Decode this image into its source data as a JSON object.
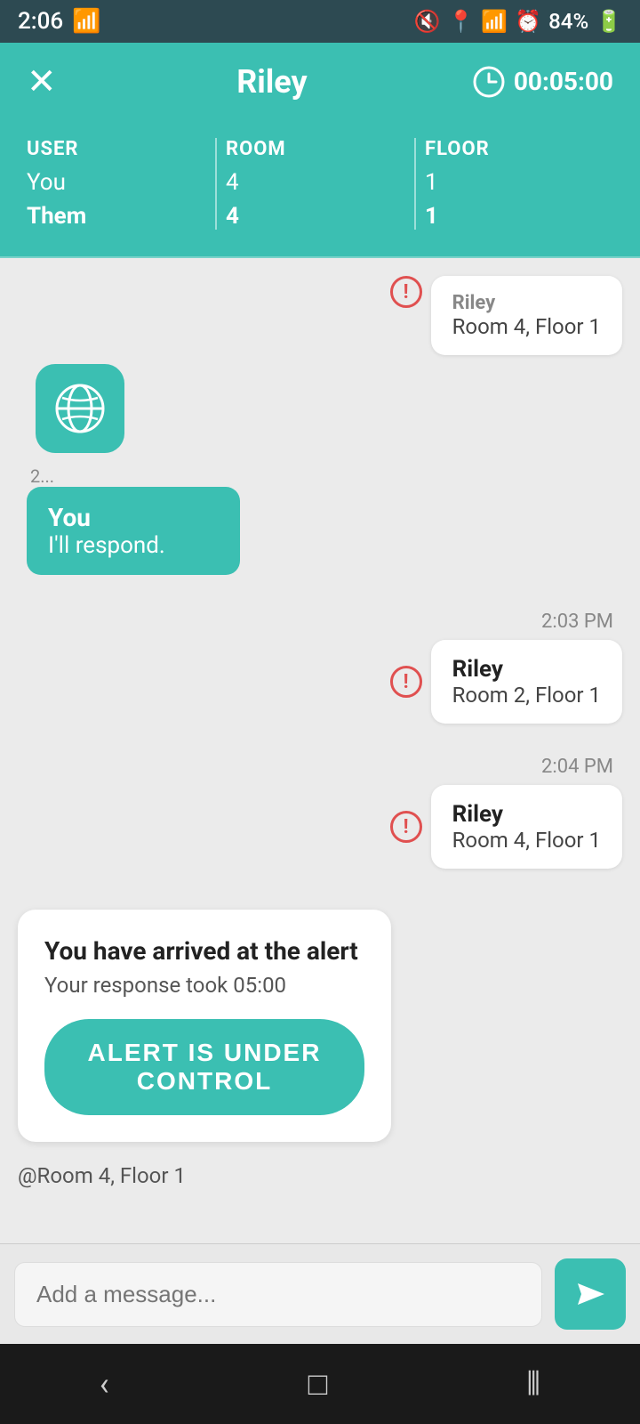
{
  "statusBar": {
    "time": "2:06",
    "battery": "84%"
  },
  "header": {
    "closeLabel": "✕",
    "title": "Riley",
    "timer": "00:05:00"
  },
  "infoTable": {
    "cols": [
      {
        "label": "USER",
        "you": "You",
        "them": "Them"
      },
      {
        "label": "ROOM",
        "you": "4",
        "them": "4"
      },
      {
        "label": "FLOOR",
        "you": "1",
        "them": "1"
      }
    ]
  },
  "messages": [
    {
      "id": "msg-partial",
      "side": "right",
      "timestamp": "",
      "sender": "Riley",
      "location": "Room 4, Floor 1",
      "showTimestamp": false
    },
    {
      "id": "msg-you-respond",
      "side": "left",
      "youLabel": "You",
      "youText": "I'll respond."
    },
    {
      "id": "msg-riley-1",
      "side": "right",
      "timestamp": "2:03 PM",
      "sender": "Riley",
      "location": "Room 2, Floor 1"
    },
    {
      "id": "msg-riley-2",
      "side": "right",
      "timestamp": "2:04 PM",
      "sender": "Riley",
      "location": "Room 4, Floor 1"
    }
  ],
  "arrivedCard": {
    "title": "You have arrived at the alert",
    "subtitle": "Your response took 05:00",
    "buttonLabel": "ALERT IS UNDER CONTROL",
    "roomLabel": "@Room 4, Floor 1"
  },
  "messageInput": {
    "placeholder": "Add a message..."
  },
  "navBar": {
    "back": "‹",
    "home": "□",
    "recents": "⦀"
  }
}
